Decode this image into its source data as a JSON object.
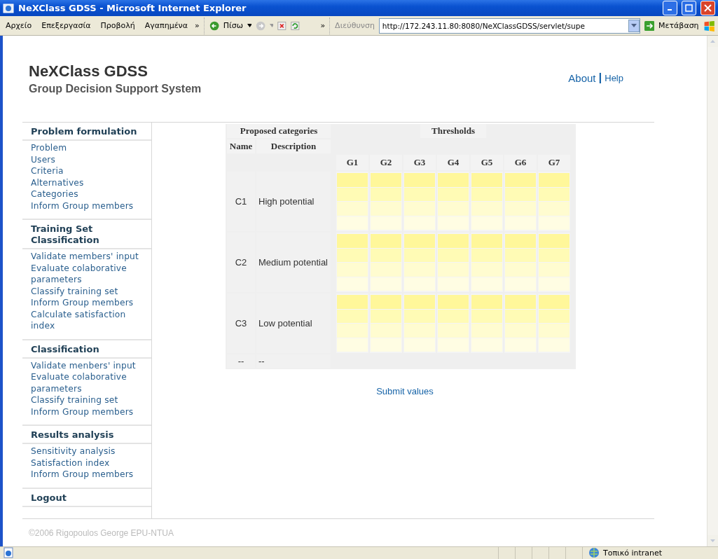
{
  "window": {
    "title": "NeXClass GDSS - Microsoft Internet Explorer"
  },
  "menu": [
    "Αρχείο",
    "Επεξεργασία",
    "Προβολή",
    "Αγαπημένα"
  ],
  "toolbar": {
    "more": "»",
    "back": "Πίσω",
    "more_2": "»",
    "address_label": "Διεύθυνση",
    "address": "http://172.243.11.80:8080/NeXClassGDSS/servlet/supe",
    "go": "Μετάβαση"
  },
  "header": {
    "title": "NeXClass GDSS",
    "subtitle": "Group Decision Support System",
    "links": [
      "About",
      "Help"
    ],
    "separator": "|"
  },
  "sidebar": [
    {
      "heading": "Problem formulation",
      "items": [
        "Problem",
        "Users",
        "Criteria",
        "Alternatives",
        "Categories",
        "Inform Group members"
      ]
    },
    {
      "heading": "Training Set Classification",
      "items": [
        "Validate members' input",
        "Evaluate colaborative parameters",
        "Classify training set",
        "Inform Group members",
        "Calculate satisfaction index"
      ]
    },
    {
      "heading": "Classification",
      "items": [
        "Validate menbers' input",
        "Evaluate colaborative parameters",
        "Classify training set",
        "Inform Group members"
      ]
    },
    {
      "heading": "Results analysis",
      "items": [
        "Sensitivity analysis",
        "Satisfaction index",
        "Inform Group members"
      ]
    },
    {
      "heading": "Logout"
    }
  ],
  "table": {
    "group_heading": "Proposed categories",
    "thresholds_heading": "Thresholds",
    "columns": [
      "Name",
      "Description"
    ],
    "groups": [
      "G1",
      "G2",
      "G3",
      "G4",
      "G5",
      "G6",
      "G7"
    ],
    "rows": [
      {
        "name": "C1",
        "description": "High potential"
      },
      {
        "name": "C2",
        "description": "Medium potential"
      },
      {
        "name": "C3",
        "description": "Low potential"
      }
    ],
    "last_row": {
      "name": "--",
      "description": "--"
    }
  },
  "submit": "Submit values",
  "footer": "©2006 Rigopoulos George EPU-NTUA",
  "status_bar": {
    "zone": "Τοπικό intranet"
  }
}
